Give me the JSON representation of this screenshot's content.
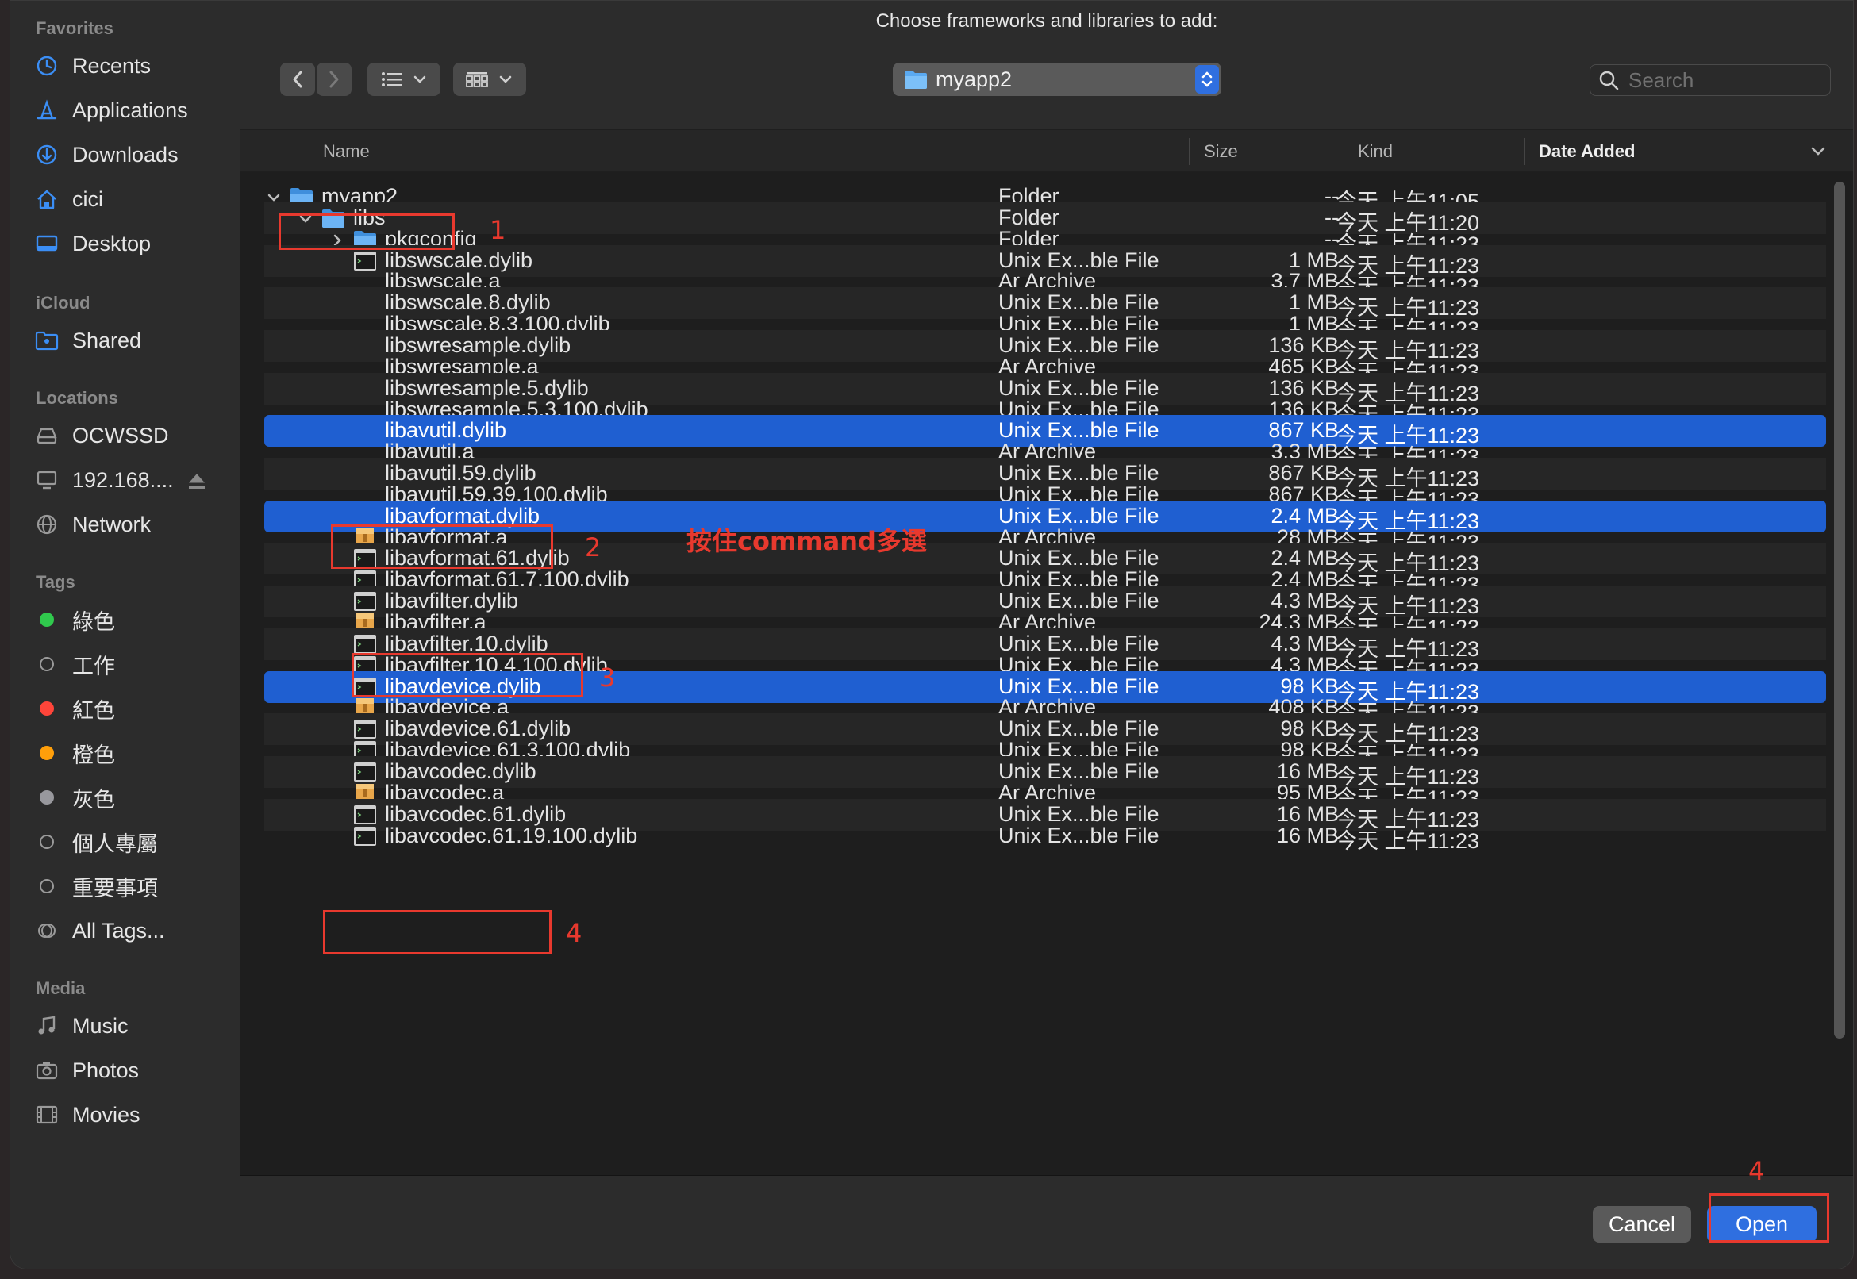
{
  "dialog_title": "Choose frameworks and libraries to add:",
  "sidebar": {
    "favorites_heading": "Favorites",
    "favorites": [
      {
        "label": "Recents",
        "icon": "clock-icon"
      },
      {
        "label": "Applications",
        "icon": "applications-icon"
      },
      {
        "label": "Downloads",
        "icon": "downloads-icon"
      },
      {
        "label": "cici",
        "icon": "home-icon"
      },
      {
        "label": "Desktop",
        "icon": "desktop-icon"
      }
    ],
    "icloud_heading": "iCloud",
    "icloud": [
      {
        "label": "Shared",
        "icon": "shared-folder-icon"
      }
    ],
    "locations_heading": "Locations",
    "locations": [
      {
        "label": "OCWSSD",
        "icon": "drive-icon"
      },
      {
        "label": "192.168....",
        "icon": "computer-icon"
      },
      {
        "label": "Network",
        "icon": "network-icon"
      }
    ],
    "tags_heading": "Tags",
    "tags": [
      {
        "label": "綠色",
        "color": "#30c94d"
      },
      {
        "label": "工作",
        "color": ""
      },
      {
        "label": "紅色",
        "color": "#ff453a"
      },
      {
        "label": "橙色",
        "color": "#ff9f0a"
      },
      {
        "label": "灰色",
        "color": "#98989d"
      },
      {
        "label": "個人專屬",
        "color": ""
      },
      {
        "label": "重要事項",
        "color": ""
      },
      {
        "label": "All Tags...",
        "color": ""
      }
    ],
    "media_heading": "Media",
    "media": [
      {
        "label": "Music",
        "icon": "music-icon"
      },
      {
        "label": "Photos",
        "icon": "photos-icon"
      },
      {
        "label": "Movies",
        "icon": "movies-icon"
      }
    ]
  },
  "toolbar": {
    "path_popup": "myapp2",
    "search_placeholder": "Search"
  },
  "columns": {
    "name": "Name",
    "size": "Size",
    "kind": "Kind",
    "date": "Date Added"
  },
  "files": [
    {
      "name": "myapp2",
      "size": "--",
      "kind": "Folder",
      "date": "今天 上午11:05",
      "level": 0,
      "type": "folder",
      "disclosure": "open"
    },
    {
      "name": "libs",
      "size": "--",
      "kind": "Folder",
      "date": "今天 上午11:20",
      "level": 1,
      "type": "folder",
      "disclosure": "open"
    },
    {
      "name": "pkgconfig",
      "size": "--",
      "kind": "Folder",
      "date": "今天 上午11:23",
      "level": 2,
      "type": "folder",
      "disclosure": "closed"
    },
    {
      "name": "libswscale.dylib",
      "size": "1 MB",
      "kind": "Unix Ex...ble File",
      "date": "今天 上午11:23",
      "level": 2,
      "type": "exec"
    },
    {
      "name": "libswscale.a",
      "size": "3.7 MB",
      "kind": "Ar Archive",
      "date": "今天 上午11:23",
      "level": 2,
      "type": "none"
    },
    {
      "name": "libswscale.8.dylib",
      "size": "1 MB",
      "kind": "Unix Ex...ble File",
      "date": "今天 上午11:23",
      "level": 2,
      "type": "none"
    },
    {
      "name": "libswscale.8.3.100.dylib",
      "size": "1 MB",
      "kind": "Unix Ex...ble File",
      "date": "今天 上午11:23",
      "level": 2,
      "type": "none"
    },
    {
      "name": "libswresample.dylib",
      "size": "136 KB",
      "kind": "Unix Ex...ble File",
      "date": "今天 上午11:23",
      "level": 2,
      "type": "none"
    },
    {
      "name": "libswresample.a",
      "size": "465 KB",
      "kind": "Ar Archive",
      "date": "今天 上午11:23",
      "level": 2,
      "type": "none"
    },
    {
      "name": "libswresample.5.dylib",
      "size": "136 KB",
      "kind": "Unix Ex...ble File",
      "date": "今天 上午11:23",
      "level": 2,
      "type": "none"
    },
    {
      "name": "libswresample.5.3.100.dylib",
      "size": "136 KB",
      "kind": "Unix Ex...ble File",
      "date": "今天 上午11:23",
      "level": 2,
      "type": "none"
    },
    {
      "name": "libavutil.dylib",
      "size": "867 KB",
      "kind": "Unix Ex...ble File",
      "date": "今天 上午11:23",
      "level": 2,
      "type": "none",
      "selected": true
    },
    {
      "name": "libavutil.a",
      "size": "3.3 MB",
      "kind": "Ar Archive",
      "date": "今天 上午11:23",
      "level": 2,
      "type": "none"
    },
    {
      "name": "libavutil.59.dylib",
      "size": "867 KB",
      "kind": "Unix Ex...ble File",
      "date": "今天 上午11:23",
      "level": 2,
      "type": "none"
    },
    {
      "name": "libavutil.59.39.100.dylib",
      "size": "867 KB",
      "kind": "Unix Ex...ble File",
      "date": "今天 上午11:23",
      "level": 2,
      "type": "none"
    },
    {
      "name": "libavformat.dylib",
      "size": "2.4 MB",
      "kind": "Unix Ex...ble File",
      "date": "今天 上午11:23",
      "level": 2,
      "type": "none",
      "selected": true
    },
    {
      "name": "libavformat.a",
      "size": "28 MB",
      "kind": "Ar Archive",
      "date": "今天 上午11:23",
      "level": 2,
      "type": "archive"
    },
    {
      "name": "libavformat.61.dylib",
      "size": "2.4 MB",
      "kind": "Unix Ex...ble File",
      "date": "今天 上午11:23",
      "level": 2,
      "type": "exec"
    },
    {
      "name": "libavformat.61.7.100.dylib",
      "size": "2.4 MB",
      "kind": "Unix Ex...ble File",
      "date": "今天 上午11:23",
      "level": 2,
      "type": "exec"
    },
    {
      "name": "libavfilter.dylib",
      "size": "4.3 MB",
      "kind": "Unix Ex...ble File",
      "date": "今天 上午11:23",
      "level": 2,
      "type": "exec"
    },
    {
      "name": "libavfilter.a",
      "size": "24.3 MB",
      "kind": "Ar Archive",
      "date": "今天 上午11:23",
      "level": 2,
      "type": "archive"
    },
    {
      "name": "libavfilter.10.dylib",
      "size": "4.3 MB",
      "kind": "Unix Ex...ble File",
      "date": "今天 上午11:23",
      "level": 2,
      "type": "exec"
    },
    {
      "name": "libavfilter.10.4.100.dylib",
      "size": "4.3 MB",
      "kind": "Unix Ex...ble File",
      "date": "今天 上午11:23",
      "level": 2,
      "type": "exec"
    },
    {
      "name": "libavdevice.dylib",
      "size": "98 KB",
      "kind": "Unix Ex...ble File",
      "date": "今天 上午11:23",
      "level": 2,
      "type": "exec",
      "selected": true
    },
    {
      "name": "libavdevice.a",
      "size": "408 KB",
      "kind": "Ar Archive",
      "date": "今天 上午11:23",
      "level": 2,
      "type": "archive"
    },
    {
      "name": "libavdevice.61.dylib",
      "size": "98 KB",
      "kind": "Unix Ex...ble File",
      "date": "今天 上午11:23",
      "level": 2,
      "type": "exec"
    },
    {
      "name": "libavdevice.61.3.100.dylib",
      "size": "98 KB",
      "kind": "Unix Ex...ble File",
      "date": "今天 上午11:23",
      "level": 2,
      "type": "exec"
    },
    {
      "name": "libavcodec.dylib",
      "size": "16 MB",
      "kind": "Unix Ex...ble File",
      "date": "今天 上午11:23",
      "level": 2,
      "type": "exec"
    },
    {
      "name": "libavcodec.a",
      "size": "95 MB",
      "kind": "Ar Archive",
      "date": "今天 上午11:23",
      "level": 2,
      "type": "archive"
    },
    {
      "name": "libavcodec.61.dylib",
      "size": "16 MB",
      "kind": "Unix Ex...ble File",
      "date": "今天 上午11:23",
      "level": 2,
      "type": "exec"
    },
    {
      "name": "libavcodec.61.19.100.dylib",
      "size": "16 MB",
      "kind": "Unix Ex...ble File",
      "date": "今天 上午11:23",
      "level": 2,
      "type": "exec"
    }
  ],
  "buttons": {
    "cancel": "Cancel",
    "open": "Open"
  },
  "annotations": {
    "n1": "1",
    "n2": "2",
    "n3": "3",
    "n4a": "4",
    "n4b": "4",
    "hint": "按住command多選",
    "color": "#e8392e"
  }
}
